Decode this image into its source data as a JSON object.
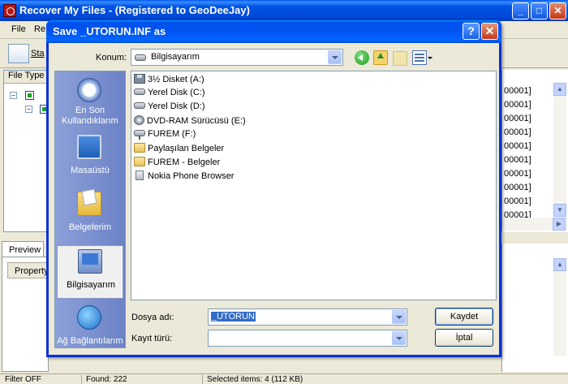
{
  "app": {
    "title": "Recover My Files  -  (Registered to GeoDeeJay)",
    "menu": [
      "File",
      "Re"
    ],
    "toolbar_start_label": "Sta",
    "left_pane_header": "File Type",
    "right_rows": [
      "00001]",
      "00001]",
      "00001]",
      "00001]",
      "00001]",
      "00001]",
      "00001]",
      "00001]",
      "00001]",
      "00001]"
    ],
    "preview_tab": "Preview",
    "properties_button": "Property",
    "status": {
      "filter": "Filter OFF",
      "found": "Found: 222",
      "selected": "Selected items: 4 (112 KB)"
    }
  },
  "dialog": {
    "title": "Save _UTORUN.INF as",
    "help_glyph": "?",
    "close_glyph": "✕",
    "location_label": "Konum:",
    "location_value": "Bilgisayarım",
    "places": [
      {
        "label": "En Son Kullandıklarım",
        "icon": "recent-documents-icon"
      },
      {
        "label": "Masaüstü",
        "icon": "desktop-icon"
      },
      {
        "label": "Belgelerim",
        "icon": "my-documents-icon"
      },
      {
        "label": "Bilgisayarım",
        "icon": "my-computer-icon"
      },
      {
        "label": "Ağ Bağlantılarım",
        "icon": "network-places-icon"
      }
    ],
    "items": [
      {
        "label": "3½ Disket (A:)",
        "icon": "floppy"
      },
      {
        "label": "Yerel Disk (C:)",
        "icon": "disk"
      },
      {
        "label": "Yerel Disk (D:)",
        "icon": "disk"
      },
      {
        "label": "DVD-RAM Sürücüsü (E:)",
        "icon": "dvd"
      },
      {
        "label": "FUREM (F:)",
        "icon": "net"
      },
      {
        "label": "Paylaşılan Belgeler",
        "icon": "folder"
      },
      {
        "label": "FUREM - Belgeler",
        "icon": "folder"
      },
      {
        "label": "Nokia Phone Browser",
        "icon": "phone"
      }
    ],
    "filename_label": "Dosya adı:",
    "filename_value": "_UTORUN",
    "filetype_label": "Kayıt türü:",
    "filetype_value": "",
    "save_button": "Kaydet",
    "cancel_button": "İptal"
  }
}
